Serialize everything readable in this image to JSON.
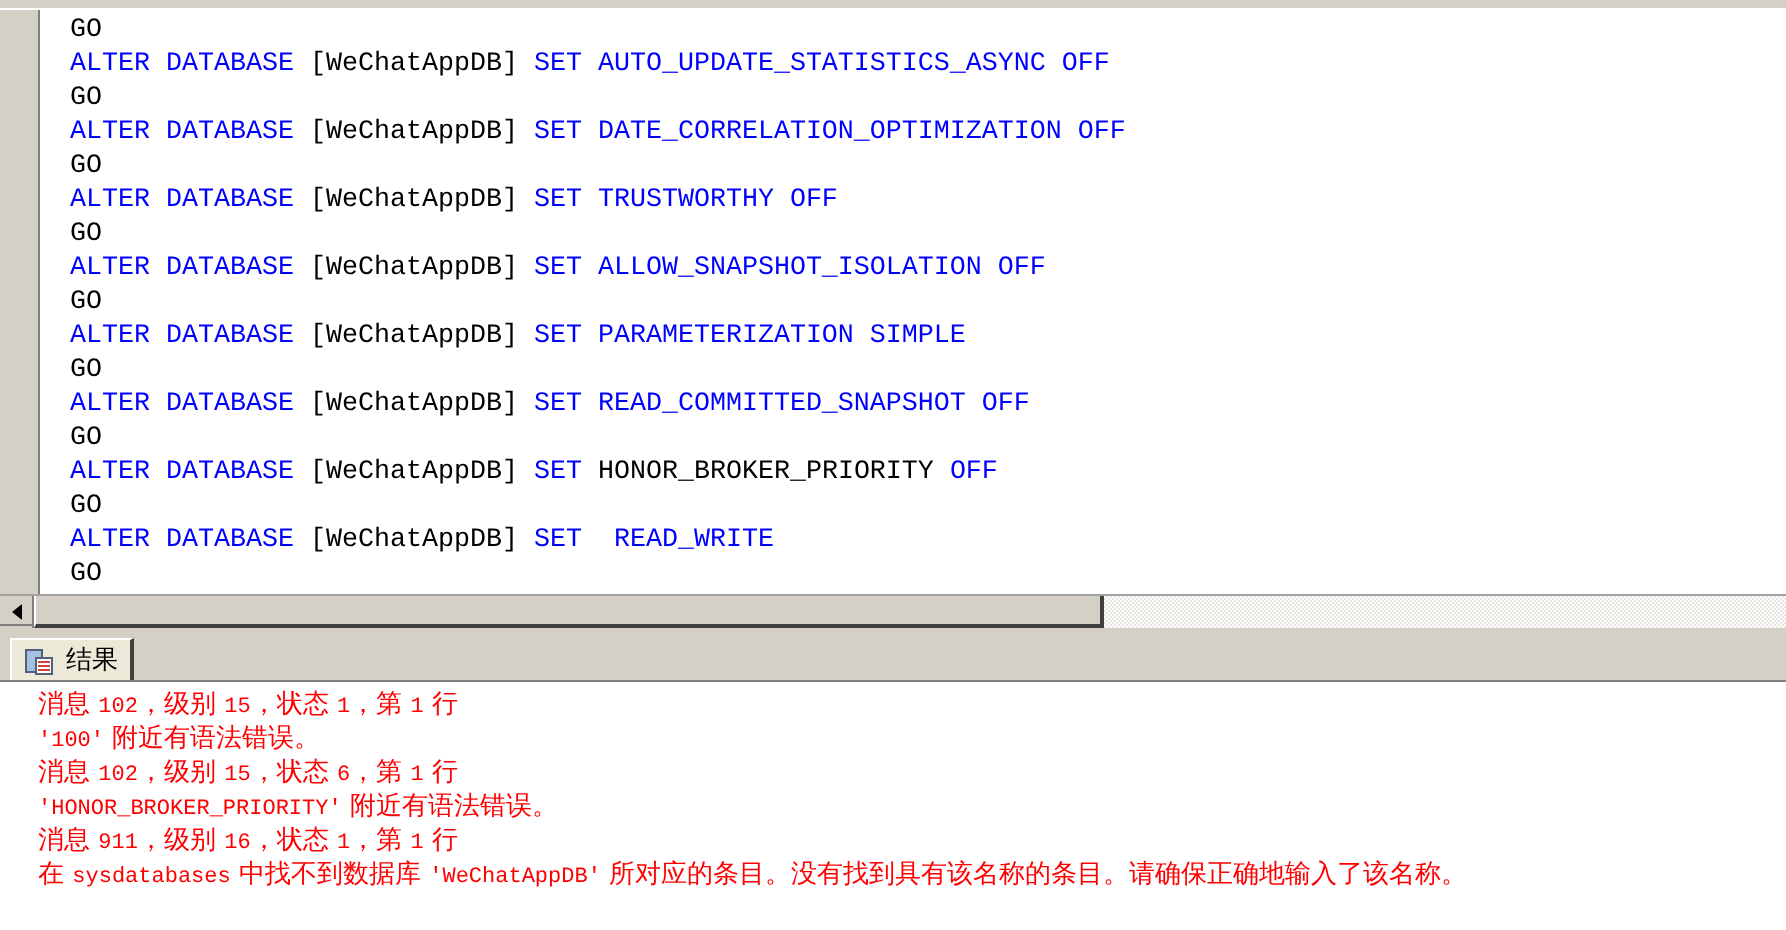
{
  "editor": {
    "lines": [
      [
        {
          "kind": "plain",
          "text": "GO"
        }
      ],
      [
        {
          "kind": "keyword",
          "text": "ALTER DATABASE"
        },
        {
          "kind": "plain",
          "text": " [WeChatAppDB] "
        },
        {
          "kind": "keyword",
          "text": "SET AUTO_UPDATE_STATISTICS_ASYNC OFF"
        }
      ],
      [
        {
          "kind": "plain",
          "text": "GO"
        }
      ],
      [
        {
          "kind": "keyword",
          "text": "ALTER DATABASE"
        },
        {
          "kind": "plain",
          "text": " [WeChatAppDB] "
        },
        {
          "kind": "keyword",
          "text": "SET DATE_CORRELATION_OPTIMIZATION OFF"
        }
      ],
      [
        {
          "kind": "plain",
          "text": "GO"
        }
      ],
      [
        {
          "kind": "keyword",
          "text": "ALTER DATABASE"
        },
        {
          "kind": "plain",
          "text": " [WeChatAppDB] "
        },
        {
          "kind": "keyword",
          "text": "SET TRUSTWORTHY OFF"
        }
      ],
      [
        {
          "kind": "plain",
          "text": "GO"
        }
      ],
      [
        {
          "kind": "keyword",
          "text": "ALTER DATABASE"
        },
        {
          "kind": "plain",
          "text": " [WeChatAppDB] "
        },
        {
          "kind": "keyword",
          "text": "SET ALLOW_SNAPSHOT_ISOLATION OFF"
        }
      ],
      [
        {
          "kind": "plain",
          "text": "GO"
        }
      ],
      [
        {
          "kind": "keyword",
          "text": "ALTER DATABASE"
        },
        {
          "kind": "plain",
          "text": " [WeChatAppDB] "
        },
        {
          "kind": "keyword",
          "text": "SET PARAMETERIZATION SIMPLE"
        }
      ],
      [
        {
          "kind": "plain",
          "text": "GO"
        }
      ],
      [
        {
          "kind": "keyword",
          "text": "ALTER DATABASE"
        },
        {
          "kind": "plain",
          "text": " [WeChatAppDB] "
        },
        {
          "kind": "keyword",
          "text": "SET READ_COMMITTED_SNAPSHOT OFF"
        }
      ],
      [
        {
          "kind": "plain",
          "text": "GO"
        }
      ],
      [
        {
          "kind": "keyword",
          "text": "ALTER DATABASE"
        },
        {
          "kind": "plain",
          "text": " [WeChatAppDB] "
        },
        {
          "kind": "keyword",
          "text": "SET"
        },
        {
          "kind": "plain",
          "text": " HONOR_BROKER_PRIORITY "
        },
        {
          "kind": "keyword",
          "text": "OFF"
        }
      ],
      [
        {
          "kind": "plain",
          "text": "GO"
        }
      ],
      [
        {
          "kind": "keyword",
          "text": "ALTER DATABASE"
        },
        {
          "kind": "plain",
          "text": " [WeChatAppDB] "
        },
        {
          "kind": "keyword",
          "text": "SET  READ_WRITE"
        }
      ],
      [
        {
          "kind": "plain",
          "text": "GO"
        }
      ]
    ]
  },
  "results_tab": {
    "label": "结果",
    "selected": true
  },
  "messages": [
    [
      {
        "kind": "text",
        "text": "消息 "
      },
      {
        "kind": "code",
        "text": "102"
      },
      {
        "kind": "text",
        "text": "，级别 "
      },
      {
        "kind": "code",
        "text": "15"
      },
      {
        "kind": "text",
        "text": "，状态 "
      },
      {
        "kind": "code",
        "text": "1"
      },
      {
        "kind": "text",
        "text": "，第 "
      },
      {
        "kind": "code",
        "text": "1"
      },
      {
        "kind": "text",
        "text": " 行"
      }
    ],
    [
      {
        "kind": "code",
        "text": "'100'"
      },
      {
        "kind": "text",
        "text": " 附近有语法错误。"
      }
    ],
    [
      {
        "kind": "text",
        "text": "消息 "
      },
      {
        "kind": "code",
        "text": "102"
      },
      {
        "kind": "text",
        "text": "，级别 "
      },
      {
        "kind": "code",
        "text": "15"
      },
      {
        "kind": "text",
        "text": "，状态 "
      },
      {
        "kind": "code",
        "text": "6"
      },
      {
        "kind": "text",
        "text": "，第 "
      },
      {
        "kind": "code",
        "text": "1"
      },
      {
        "kind": "text",
        "text": " 行"
      }
    ],
    [
      {
        "kind": "code",
        "text": "'HONOR_BROKER_PRIORITY'"
      },
      {
        "kind": "text",
        "text": " 附近有语法错误。"
      }
    ],
    [
      {
        "kind": "text",
        "text": "消息 "
      },
      {
        "kind": "code",
        "text": "911"
      },
      {
        "kind": "text",
        "text": "，级别 "
      },
      {
        "kind": "code",
        "text": "16"
      },
      {
        "kind": "text",
        "text": "，状态 "
      },
      {
        "kind": "code",
        "text": "1"
      },
      {
        "kind": "text",
        "text": "，第 "
      },
      {
        "kind": "code",
        "text": "1"
      },
      {
        "kind": "text",
        "text": " 行"
      }
    ],
    [
      {
        "kind": "text",
        "text": "在 "
      },
      {
        "kind": "code",
        "text": "sysdatabases"
      },
      {
        "kind": "text",
        "text": " 中找不到数据库 "
      },
      {
        "kind": "code",
        "text": "'WeChatAppDB'"
      },
      {
        "kind": "text",
        "text": " 所对应的条目。没有找到具有该名称的条目。请确保正确地输入了该名称。"
      }
    ]
  ]
}
